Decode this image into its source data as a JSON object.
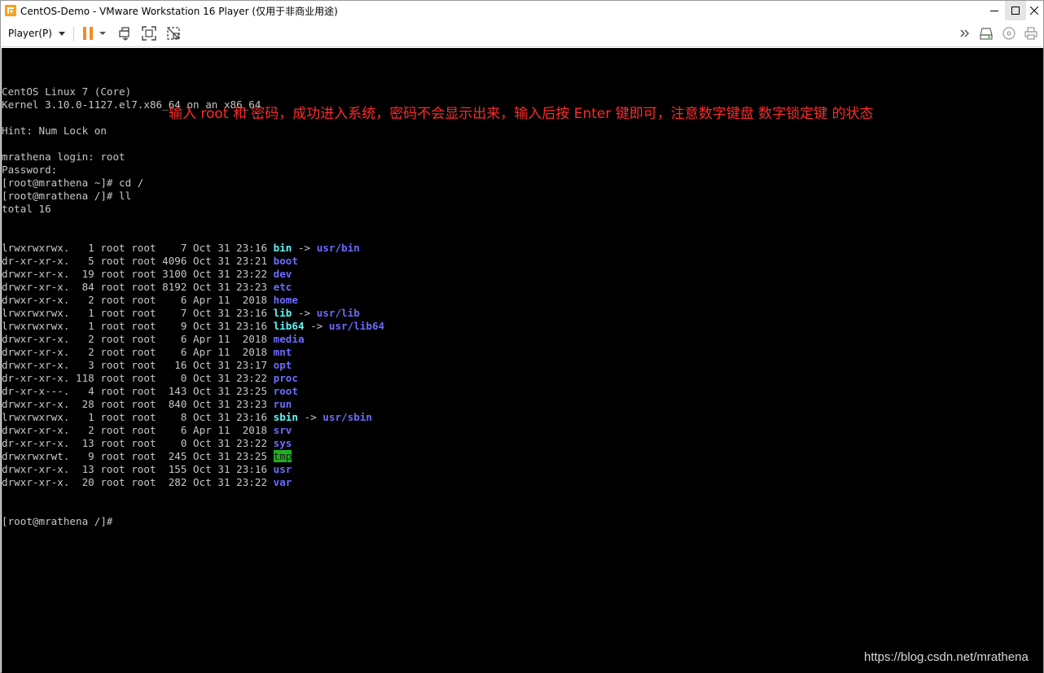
{
  "window": {
    "title": "CentOS-Demo - VMware Workstation 16 Player (仅用于非商业用途)"
  },
  "toolbar": {
    "player_menu_label": "Player(P)"
  },
  "terminal": {
    "header": [
      "CentOS Linux 7 (Core)",
      "Kernel 3.10.0-1127.el7.x86_64 on an x86_64",
      "",
      "Hint: Num Lock on",
      "",
      "mrathena login: root",
      "Password:",
      "[root@mrathena ~]# cd /",
      "[root@mrathena /]# ll",
      "total 16"
    ],
    "listing": [
      {
        "meta": "lrwxrwxrwx.   1 root root    7 Oct 31 23:16 ",
        "name": "bin",
        "type": "link",
        "target": "usr/bin"
      },
      {
        "meta": "dr-xr-xr-x.   5 root root 4096 Oct 31 23:21 ",
        "name": "boot",
        "type": "dir",
        "target": ""
      },
      {
        "meta": "drwxr-xr-x.  19 root root 3100 Oct 31 23:22 ",
        "name": "dev",
        "type": "dir",
        "target": ""
      },
      {
        "meta": "drwxr-xr-x.  84 root root 8192 Oct 31 23:23 ",
        "name": "etc",
        "type": "dir",
        "target": ""
      },
      {
        "meta": "drwxr-xr-x.   2 root root    6 Apr 11  2018 ",
        "name": "home",
        "type": "dir",
        "target": ""
      },
      {
        "meta": "lrwxrwxrwx.   1 root root    7 Oct 31 23:16 ",
        "name": "lib",
        "type": "link",
        "target": "usr/lib"
      },
      {
        "meta": "lrwxrwxrwx.   1 root root    9 Oct 31 23:16 ",
        "name": "lib64",
        "type": "link",
        "target": "usr/lib64"
      },
      {
        "meta": "drwxr-xr-x.   2 root root    6 Apr 11  2018 ",
        "name": "media",
        "type": "dir",
        "target": ""
      },
      {
        "meta": "drwxr-xr-x.   2 root root    6 Apr 11  2018 ",
        "name": "mnt",
        "type": "dir",
        "target": ""
      },
      {
        "meta": "drwxr-xr-x.   3 root root   16 Oct 31 23:17 ",
        "name": "opt",
        "type": "dir",
        "target": ""
      },
      {
        "meta": "dr-xr-xr-x. 118 root root    0 Oct 31 23:22 ",
        "name": "proc",
        "type": "dir",
        "target": ""
      },
      {
        "meta": "dr-xr-x---.   4 root root  143 Oct 31 23:25 ",
        "name": "root",
        "type": "dir",
        "target": ""
      },
      {
        "meta": "drwxr-xr-x.  28 root root  840 Oct 31 23:23 ",
        "name": "run",
        "type": "dir",
        "target": ""
      },
      {
        "meta": "lrwxrwxrwx.   1 root root    8 Oct 31 23:16 ",
        "name": "sbin",
        "type": "link",
        "target": "usr/sbin"
      },
      {
        "meta": "drwxr-xr-x.   2 root root    6 Apr 11  2018 ",
        "name": "srv",
        "type": "dir",
        "target": ""
      },
      {
        "meta": "dr-xr-xr-x.  13 root root    0 Oct 31 23:22 ",
        "name": "sys",
        "type": "dir",
        "target": ""
      },
      {
        "meta": "drwxrwxrwt.   9 root root  245 Oct 31 23:25 ",
        "name": "tmp",
        "type": "sticky",
        "target": ""
      },
      {
        "meta": "drwxr-xr-x.  13 root root  155 Oct 31 23:16 ",
        "name": "usr",
        "type": "dir",
        "target": ""
      },
      {
        "meta": "drwxr-xr-x.  20 root root  282 Oct 31 23:22 ",
        "name": "var",
        "type": "dir",
        "target": ""
      }
    ],
    "link_arrow": " -> ",
    "prompt": "[root@mrathena /]#"
  },
  "annotation": "输入 root 和 密码，成功进入系统，密码不会显示出来，输入后按 Enter 键即可，注意数字键盘 数字锁定键 的状态",
  "watermark": "https://blog.csdn.net/mrathena",
  "colors": {
    "terminal_bg": "#000000",
    "terminal_fg": "#c7c7c7",
    "link_color": "#5ff5f5",
    "dir_color": "#6b6bff",
    "sticky_bg": "#1fae1f",
    "annotation": "#ff2a2a",
    "pause_orange": "#f28c28"
  },
  "icons": {
    "app": "vmware-icon",
    "pause": "pause-icon",
    "send_ctrl_alt_del": "send-keys-icon",
    "fullscreen": "fullscreen-icon",
    "unity": "unity-icon",
    "more": "double-chevron-icon",
    "hdd": "hard-disk-icon",
    "cd": "cd-icon",
    "printer": "printer-icon"
  }
}
